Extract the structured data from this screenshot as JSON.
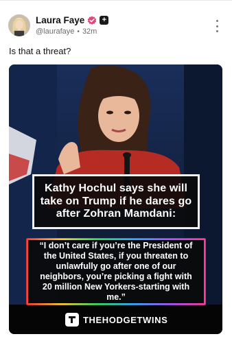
{
  "post": {
    "author": {
      "display_name": "Laura Faye",
      "handle": "@laurafaye",
      "time": "32m"
    },
    "text": "Is that a threat?",
    "image": {
      "headline": "Kathy Hochul says she will take on Trump if he dares go after Zohran Mamdani:",
      "quote": "“I don’t care if you’re the President of the United States, if you threaten to unlawfully go after one of our neighbors, you’re picking a fight with 20 million New Yorkers-starting with me.”",
      "brand": "THEHODGETWINS"
    }
  },
  "icons": {
    "verified": "verified-badge-icon",
    "plus": "plus-badge-icon",
    "more": "more-options-icon",
    "brand_logo": "thehodgetwins-logo-icon"
  },
  "colors": {
    "verified_badge": "#e0457b",
    "media_bg": "#0f1f3c",
    "text_secondary": "#6b6b6b"
  }
}
